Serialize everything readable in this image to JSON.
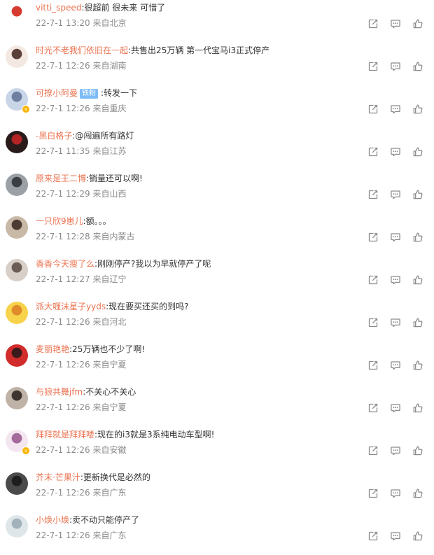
{
  "icons": {
    "share": "share-icon",
    "comment": "comment-icon",
    "like": "thumbs-up-icon"
  },
  "colors": {
    "username": "#eb7350",
    "meta": "#8a8a8a",
    "fan_tag": "#7ebcf5",
    "verified_badge": "#f7b500",
    "icon": "#8a8a8a"
  },
  "comments": [
    {
      "user": "vitti_speed",
      "text": ":很超前 很未来 可惜了",
      "time": "22-7-1 13:20",
      "location": "来自北京"
    },
    {
      "user": "时光不老我们依旧在一起",
      "text": ":共售出25万辆 第一代宝马i3正式停产",
      "time": "22-7-1 12:26",
      "location": "来自湖南"
    },
    {
      "user": "可撩小阿曼",
      "tag": "铁粉",
      "text": ":转发一下",
      "time": "22-7-1 12:26",
      "location": "来自重庆",
      "verified": true
    },
    {
      "user": "-黑白格子",
      "text": ":@闯遍所有路灯",
      "time": "22-7-1 11:35",
      "location": "来自江苏"
    },
    {
      "user": "原来是王二博",
      "text": ":销量还可以啊!",
      "time": "22-7-1 12:29",
      "location": "来自山西"
    },
    {
      "user": "一只欣9崽儿",
      "text": ":额。。。",
      "time": "22-7-1 12:28",
      "location": "来自内蒙古"
    },
    {
      "user": "香香今天瘦了么",
      "text": ":刚刚停产?我以为早就停产了呢",
      "time": "22-7-1 12:27",
      "location": "来自辽宁"
    },
    {
      "user": "派大喱沫星子yyds",
      "text": ":现在要买还买的到吗?",
      "time": "22-7-1 12:26",
      "location": "来自河北"
    },
    {
      "user": "麦丽艳艳",
      "text": ":25万辆也不少了啊!",
      "time": "22-7-1 12:26",
      "location": "来自宁夏"
    },
    {
      "user": "与狼共舞jfm",
      "text": ":不关心不关心",
      "time": "22-7-1 12:26",
      "location": "来自宁夏"
    },
    {
      "user": "拜拜就是拜拜喽",
      "text": ":现在的i3就是3系纯电动车型啊!",
      "time": "22-7-1 12:26",
      "location": "来自安徽",
      "verified": true
    },
    {
      "user": "芥末·芒果汁",
      "text": ":更新换代是必然的",
      "time": "22-7-1 12:26",
      "location": "来自广东"
    },
    {
      "user": "小焕小焕",
      "text": ":卖不动只能停产了",
      "time": "22-7-1 12:26",
      "location": "来自广东"
    }
  ]
}
